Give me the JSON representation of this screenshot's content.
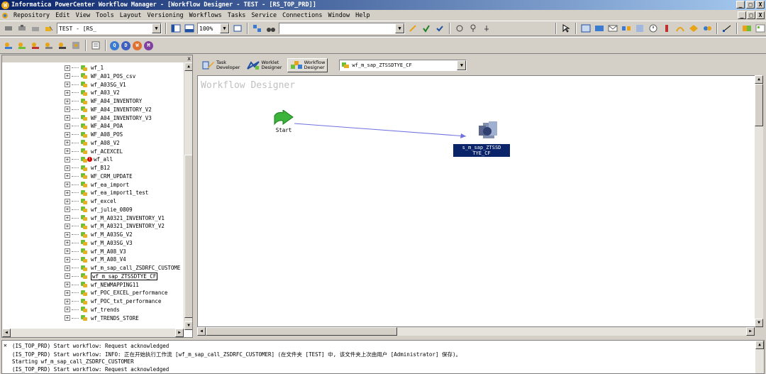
{
  "window": {
    "title": "Informatica PowerCenter Workflow Manager - [Workflow Designer - TEST - [RS_TOP_PRD]]",
    "app_icon_letter": "W",
    "minimize": "_",
    "restore": "□",
    "close": "X"
  },
  "menu": {
    "items": [
      "Repository",
      "Edit",
      "View",
      "Tools",
      "Layout",
      "Versioning",
      "Workflows",
      "Tasks",
      "Service",
      "Connections",
      "Window",
      "Help"
    ]
  },
  "toolbar": {
    "folder_combo": "TEST - [RS_",
    "zoom_combo": "100%",
    "search_combo": ""
  },
  "toolbar2": {
    "circle_buttons": [
      "Q",
      "D",
      "W",
      "M"
    ]
  },
  "navigator": {
    "close_label": "x",
    "items": [
      {
        "label": "wf_1",
        "error": false,
        "selected": false
      },
      {
        "label": "WF_A01_POS_csv",
        "error": false,
        "selected": false
      },
      {
        "label": "wf_A03SG_V1",
        "error": false,
        "selected": false
      },
      {
        "label": "wf_A03_V2",
        "error": false,
        "selected": false
      },
      {
        "label": "WF_A04_INVENTORY",
        "error": false,
        "selected": false
      },
      {
        "label": "WF_A04_INVENTORY_V2",
        "error": false,
        "selected": false
      },
      {
        "label": "WF_A04_INVENTORY_V3",
        "error": false,
        "selected": false
      },
      {
        "label": "WF_A04_POA",
        "error": false,
        "selected": false
      },
      {
        "label": "WF_A08_POS",
        "error": false,
        "selected": false
      },
      {
        "label": "wf_A08_V2",
        "error": false,
        "selected": false
      },
      {
        "label": "wf_ACEXCEL",
        "error": false,
        "selected": false
      },
      {
        "label": "wf_all",
        "error": true,
        "selected": false
      },
      {
        "label": "wf_B12",
        "error": false,
        "selected": false
      },
      {
        "label": "WF_CRM_UPDATE",
        "error": false,
        "selected": false
      },
      {
        "label": "wf_ea_import",
        "error": false,
        "selected": false
      },
      {
        "label": "wf_ea_import1_test",
        "error": false,
        "selected": false
      },
      {
        "label": "wf_excel",
        "error": false,
        "selected": false
      },
      {
        "label": "wf_julie_0809",
        "error": false,
        "selected": false
      },
      {
        "label": "wf_M_A0321_INVENTORY_V1",
        "error": false,
        "selected": false
      },
      {
        "label": "wf_M_A0321_INVENTORY_V2",
        "error": false,
        "selected": false
      },
      {
        "label": "wf_M_A03SG_V2",
        "error": false,
        "selected": false
      },
      {
        "label": "wf_M_A03SG_V3",
        "error": false,
        "selected": false
      },
      {
        "label": "wf_M_A08_V3",
        "error": false,
        "selected": false
      },
      {
        "label": "wf_M_A08_V4",
        "error": false,
        "selected": false
      },
      {
        "label": "wf_m_sap_call_ZSDRFC_CUSTOME",
        "error": false,
        "selected": false
      },
      {
        "label": "wf_m_sap_ZTSSDTYE_CF",
        "error": false,
        "selected": true
      },
      {
        "label": "wf_NEWMAPPING11",
        "error": false,
        "selected": false
      },
      {
        "label": "wf_POC_EXCEL_performance",
        "error": false,
        "selected": false
      },
      {
        "label": "wf_POC_txt_performance",
        "error": false,
        "selected": false
      },
      {
        "label": "wf_trends",
        "error": false,
        "selected": false
      },
      {
        "label": "wf_TRENDS_STORE",
        "error": false,
        "selected": false
      }
    ]
  },
  "designer": {
    "tabs": [
      {
        "line1": "Task",
        "line2": "Developer"
      },
      {
        "line1": "Worklet",
        "line2": "Designer"
      },
      {
        "line1": "Workflow",
        "line2": "Designer"
      }
    ],
    "workflow_combo": "wf_m_sap_ZTSSDTYE_CF",
    "canvas_title": "Workflow Designer",
    "start_label": "Start",
    "session_label_line1": "s_m_sap_ZTSSD",
    "session_label_line2": "TYE_CF"
  },
  "output": {
    "lines": [
      "(IS_TOP_PRD) Start workflow: Request acknowledged",
      "(IS_TOP_PRD) Start workflow: INFO: 正在开始执行工作流 [wf_m_sap_call_ZSDRFC_CUSTOMER] (在文件夹 [TEST] 中, 该文件夹上次由用户 [Administrator] 保存)。",
      "Starting wf_m_sap_call_ZSDRFC_CUSTOMER",
      "(IS_TOP_PRD) Start workflow: Request acknowledged"
    ]
  },
  "colors": {
    "titlebar": "#0a246a",
    "selection": "#0a246a",
    "start_green": "#3cb43c",
    "link_line": "#7070e0"
  }
}
